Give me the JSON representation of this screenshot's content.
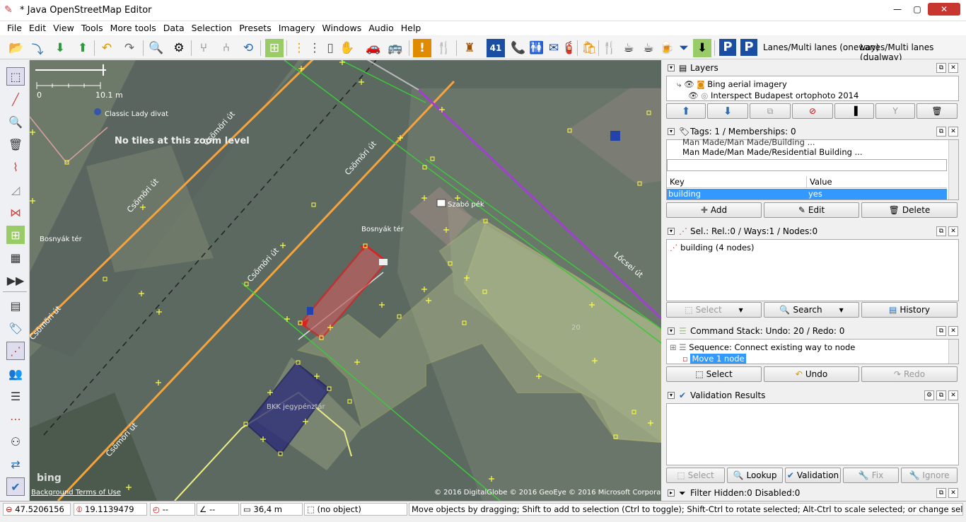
{
  "window": {
    "title": "* Java OpenStreetMap Editor",
    "minimize": "—",
    "maximize": "▢",
    "close": "✕"
  },
  "menu": [
    "File",
    "Edit",
    "View",
    "Tools",
    "More tools",
    "Data",
    "Selection",
    "Presets",
    "Imagery",
    "Windows",
    "Audio",
    "Help"
  ],
  "toolbar": {
    "preset1": "Lanes/Multi lanes (oneway)",
    "preset2": "Lanes/Multi lanes (dualway)",
    "p_label": "P",
    "num41": "41"
  },
  "map": {
    "scale_zero": "0",
    "scale_len": "10.1 m",
    "no_tiles": "No tiles at this zoom level",
    "labels": {
      "classic": "Classic Lady divat",
      "bosnyak1": "Bosnyák tér",
      "bosnyak2": "Bosnyák tér",
      "szabo": "Szabó pék",
      "bkk": "BKK jegypénztár",
      "locsei": "Lőcsei út",
      "csomori": "Csömöri út",
      "n20": "20"
    },
    "attribution": "© 2016 DigitalGlobe © 2016 GeoEye © 2016 Microsoft Corporation",
    "terms": "Background Terms of Use",
    "bing": "bing"
  },
  "layers": {
    "title": "Layers",
    "items": [
      "Bing aerial imagery",
      "Interspect Budapest ortophoto 2014"
    ]
  },
  "tags": {
    "title": "Tags: 1 / Memberships: 0",
    "preset_partial": "Man Made/Man Made/Building ...",
    "preset": "Man Made/Man Made/Residential Building ...",
    "col_key": "Key",
    "col_value": "Value",
    "rows": [
      {
        "key": "building",
        "value": "yes"
      }
    ],
    "add": "Add",
    "edit": "Edit",
    "delete": "Delete"
  },
  "selection": {
    "title": "Sel.: Rel.:0 / Ways:1 / Nodes:0",
    "item": "building (4 nodes)",
    "select": "Select",
    "search": "Search",
    "history": "History"
  },
  "commands": {
    "title": "Command Stack: Undo: 20 / Redo: 0",
    "items": [
      "Sequence: Connect existing way to node",
      "Move 1 node"
    ],
    "select": "Select",
    "undo": "Undo",
    "redo": "Redo"
  },
  "validation": {
    "title": "Validation Results",
    "select": "Select",
    "lookup": "Lookup",
    "validation": "Validation",
    "fix": "Fix",
    "ignore": "Ignore"
  },
  "filter": {
    "title": "Filter Hidden:0 Disabled:0"
  },
  "status": {
    "lat": "47.5206156",
    "lon": "19.1139479",
    "heading": "--",
    "angle": "--",
    "distance": "36,4 m",
    "object": "(no object)",
    "help": "Move objects by dragging; Shift to add to selection (Ctrl to toggle); Shift-Ctrl to rotate selected; Alt-Ctrl to scale selected; or change selection"
  },
  "colors": {
    "selection_red": "#e02020",
    "road_orange": "#f5a33a",
    "tram_green": "#3cc83c",
    "path_purple": "#a040d0",
    "landuse_yellow": "#f0f080",
    "building_pink": "#d8a0a0",
    "bkk_navy": "#2a2a7a",
    "highlight_blue": "#3399ff"
  }
}
